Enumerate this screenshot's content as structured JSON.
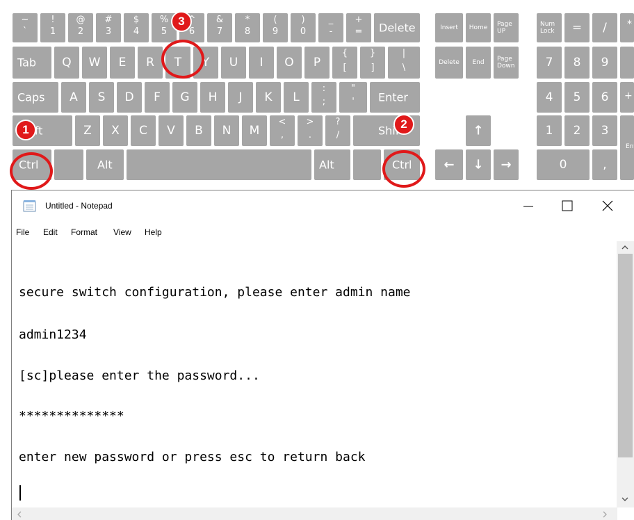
{
  "keyboard": {
    "row1": [
      {
        "up": "~",
        "dn": "`"
      },
      {
        "up": "!",
        "dn": "1"
      },
      {
        "up": "@",
        "dn": "2"
      },
      {
        "up": "#",
        "dn": "3"
      },
      {
        "up": "$",
        "dn": "4"
      },
      {
        "up": "%",
        "dn": "5"
      },
      {
        "up": "^",
        "dn": "6"
      },
      {
        "up": "&",
        "dn": "7"
      },
      {
        "up": "*",
        "dn": "8"
      },
      {
        "up": "(",
        "dn": "9"
      },
      {
        "up": ")",
        "dn": "0"
      },
      {
        "up": "_",
        "dn": "-"
      },
      {
        "up": "+",
        "dn": "="
      }
    ],
    "delete": "Delete",
    "tab": "Tab",
    "row2": [
      "Q",
      "W",
      "E",
      "R",
      "T",
      "Y",
      "U",
      "I",
      "O",
      "P"
    ],
    "row2_syms": [
      {
        "up": "{",
        "dn": "["
      },
      {
        "up": "}",
        "dn": "]"
      },
      {
        "up": "|",
        "dn": "\\"
      }
    ],
    "caps": "Caps",
    "row3": [
      "A",
      "S",
      "D",
      "F",
      "G",
      "H",
      "J",
      "K",
      "L"
    ],
    "row3_syms": [
      {
        "up": ":",
        "dn": ";"
      },
      {
        "up": "\"",
        "dn": "'"
      }
    ],
    "enter": "Enter",
    "shift_left": "Shift",
    "row4": [
      "Z",
      "X",
      "C",
      "V",
      "B",
      "N",
      "M"
    ],
    "row4_syms": [
      {
        "up": "<",
        "dn": ","
      },
      {
        "up": ">",
        "dn": "."
      },
      {
        "up": "?",
        "dn": "/"
      }
    ],
    "shift_right": "Shift",
    "ctrl_left": "Ctrl",
    "alt_left": "Alt",
    "alt_right": "Alt",
    "ctrl_right": "Ctrl",
    "nav": {
      "insert": "Insert",
      "home": "Home",
      "page_up": "Page\nUP",
      "delete": "Delete",
      "end": "End",
      "page_down": "Page\nDown"
    },
    "arrows": {
      "up": "↑",
      "left": "←",
      "down": "↓",
      "right": "→"
    },
    "numpad": {
      "num_lock": "Num\nLock",
      "eq": "=",
      "div": "/",
      "mul": "*",
      "n7": "7",
      "n8": "8",
      "n9": "9",
      "n4": "4",
      "n5": "5",
      "n6": "6",
      "n1": "1",
      "n2": "2",
      "n3": "3",
      "n0": "0",
      "dot": ",",
      "enter": "Enter"
    }
  },
  "annotations": {
    "badge1": "1",
    "badge2": "2",
    "badge3": "3",
    "accent": "#e0191a"
  },
  "notepad": {
    "title": "Untitled - Notepad",
    "menu": [
      "File",
      "Edit",
      "Format",
      "View",
      "Help"
    ],
    "lines": [
      "secure switch configuration, please enter admin name",
      "admin1234",
      "[sc]please enter the password...",
      "**************",
      "enter new password or press esc to return back"
    ]
  }
}
